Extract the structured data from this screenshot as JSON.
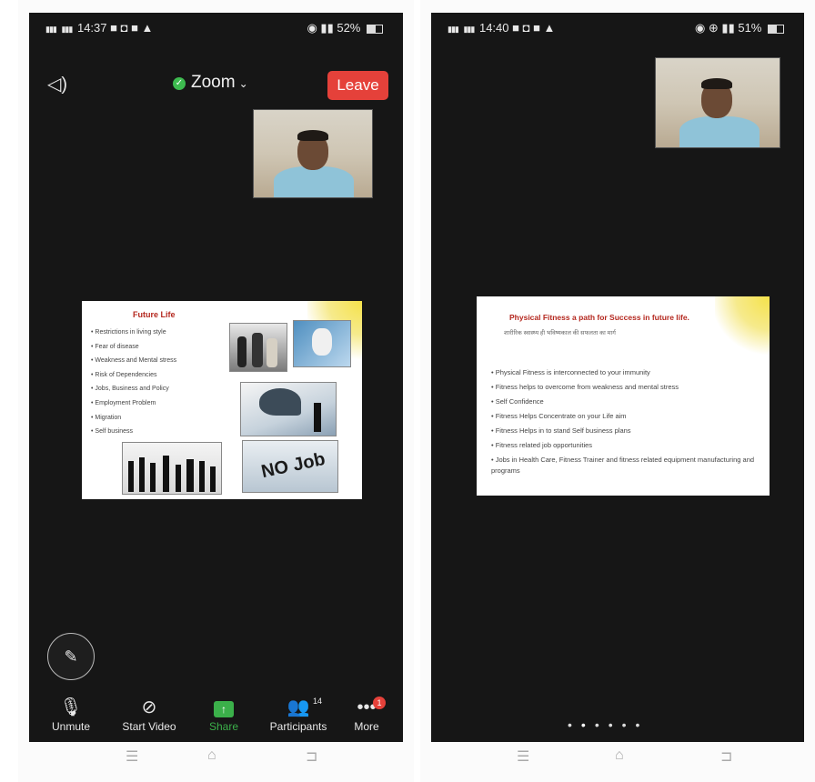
{
  "left_screen": {
    "status": {
      "time": "14:37",
      "battery": "52%"
    },
    "topbar": {
      "meeting_title": "Zoom",
      "leave_label": "Leave"
    },
    "slide": {
      "title": "Future Life",
      "bullets": [
        "Restrictions in living style",
        "Fear of disease",
        "Weakness and Mental stress",
        "Risk of Dependencies",
        "Jobs, Business and Policy",
        "Employment Problem",
        "Migration",
        "Self business"
      ],
      "image_text": "NO Job"
    },
    "toolbar": {
      "unmute": "Unmute",
      "start_video": "Start Video",
      "share": "Share",
      "participants": "Participants",
      "participants_count": "14",
      "more": "More",
      "more_badge": "1"
    }
  },
  "right_screen": {
    "status": {
      "time": "14:40",
      "battery": "51%"
    },
    "slide": {
      "title": "Physical Fitness a path for Success in future life.",
      "subtitle": "शारीरिक स्वास्थ्य ही भविष्यकाल की सफलता का मार्ग",
      "bullets": [
        "Physical Fitness is interconnected to your immunity",
        "Fitness helps to overcome from weakness and mental stress",
        "Self Confidence",
        "Fitness Helps Concentrate on your Life aim",
        "Fitness Helps in to stand Self business plans",
        "Fitness related job opportunities",
        "Jobs in Health Care, Fitness Trainer and fitness related equipment manufacturing and programs"
      ]
    }
  }
}
